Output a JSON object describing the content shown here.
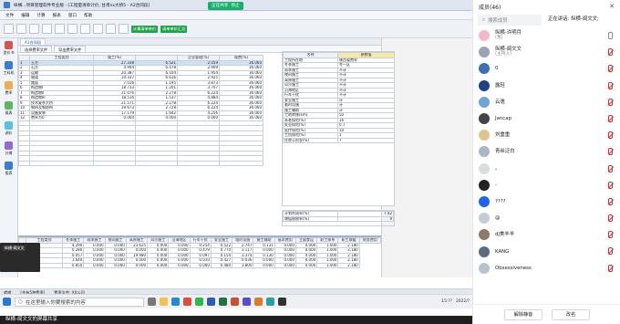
{
  "app": {
    "title": "纵横...项目管理软件专业版 - [工程量清单计价, 甘肃xx大桥5 - A2合同段]",
    "share_label": "纵横-阆文文的屏幕共享",
    "share_pill": "正在共享",
    "share_stop": "停止"
  },
  "menu": [
    "文件",
    "编辑",
    "计算",
    "报表",
    "窗口",
    "帮助"
  ],
  "toolbar": {
    "green1": "计算清单单价",
    "green2": "清单单价汇总"
  },
  "nav": [
    "造价书",
    "工料机",
    "费率",
    "报表",
    "调价",
    "分摊",
    "报表"
  ],
  "tabs": [
    "A1合同段"
  ],
  "sub_tabs": [
    "选择费率文件",
    "导出费率文件"
  ],
  "left_table": {
    "headers": [
      "工程类别",
      "施工(%)",
      "企业管理(%)",
      "规费(%)"
    ],
    "rows": [
      [
        "土方",
        "27.338",
        "6.521",
        "2.059",
        "36.060"
      ],
      [
        "石方",
        "4.994",
        "6.478",
        "2.909",
        "36.060"
      ],
      [
        "运输",
        "20.387",
        "6.104",
        "1.954",
        "36.060"
      ],
      [
        "隧道",
        "10.337",
        "6.616",
        "2.925",
        "36.060"
      ],
      [
        "路面",
        "7.016",
        "1.195",
        "3.873",
        "36.060"
      ],
      [
        "构造物I",
        "18.733",
        "1.201",
        "3.707",
        "36.060"
      ],
      [
        "构造物II",
        "21.076",
        "2.278",
        "6.224",
        "36.060"
      ],
      [
        "构造物III",
        "18.516",
        "1.537",
        "4.884",
        "36.060"
      ],
      [
        "技术复杂大桥",
        "21.571",
        "2.278",
        "6.224",
        "36.060"
      ],
      [
        "钢材及钢结构",
        "19.673",
        "2.728",
        "6.224",
        "36.060"
      ],
      [
        "设备安装",
        "17.179",
        "1.642",
        "4.256",
        "36.060"
      ],
      [
        "费率为0",
        "0.000",
        "0.000",
        "0.000",
        "36.060"
      ]
    ]
  },
  "right_table": {
    "headers": [
      "名称",
      "参数值"
    ],
    "rows": [
      [
        "工程所在地",
        "陕西省费率"
      ],
      [
        "冬季施工",
        "冬一区"
      ],
      [
        "雨季施工",
        "不计"
      ],
      [
        "夜间施工",
        "不计"
      ],
      [
        "高原施工",
        "不计"
      ],
      [
        "风沙施工",
        "不计"
      ],
      [
        "沿海地区",
        "不计"
      ],
      [
        "行车干扰",
        "不计"
      ],
      [
        "安全施工",
        "计"
      ],
      [
        "临时设施",
        "计"
      ],
      [
        "施工辅助",
        "计"
      ],
      [
        "工地转移(km)",
        "50"
      ],
      [
        "养老保险(%)",
        "16"
      ],
      [
        "失业保险(%)",
        "0.7"
      ],
      [
        "医疗保险(%)",
        "10"
      ],
      [
        "工伤保险(%)",
        "1"
      ],
      [
        "住房公积金(%)",
        "7"
      ]
    ],
    "extra_labels": [
      "计划利润率(%)",
      "增值税税率(%)"
    ],
    "extra_values": [
      "7.42",
      "9"
    ]
  },
  "bottom_table": {
    "headers": [
      "工程类别",
      "冬季施工",
      "雨季施工",
      "夜间施工",
      "高原施工",
      "风沙施工",
      "沿海地区",
      "行车干扰",
      "安全施工",
      "临时设施",
      "施工辅助",
      "基本费用",
      "主副食运",
      "职工探亲",
      "职工取暖",
      "财务费用"
    ],
    "rows": [
      [
        "土方",
        "4.290",
        "0.000",
        "0.000",
        "23.625",
        "0.000",
        "0.000",
        "0.254",
        "0.522",
        "2.747",
        "0.131",
        "0.000",
        "0.000",
        "1.000",
        "2.180"
      ],
      [
        "石方",
        "0.280",
        "0.000",
        "0.000",
        "0.000",
        "0.000",
        "0.000",
        "0.479",
        "0.770",
        "3.117",
        "0.000",
        "0.000",
        "0.000",
        "1.000",
        "2.180"
      ],
      [
        "运输",
        "0.057",
        "0.000",
        "0.000",
        "19.980",
        "0.000",
        "0.000",
        "0.097",
        "0.154",
        "3.374",
        "0.130",
        "0.000",
        "0.000",
        "1.000",
        "2.180"
      ],
      [
        "隧道",
        "1.640",
        "0.000",
        "0.000",
        "0.000",
        "0.000",
        "0.000",
        "0.010",
        "0.427",
        "0.036",
        "0.000",
        "0.000",
        "0.000",
        "1.000",
        "2.180"
      ],
      [
        "路面",
        "0.850",
        "0.000",
        "0.000",
        "0.000",
        "0.000",
        "0.000",
        "0.000",
        "0.480",
        "3.800",
        "0.000",
        "0.000",
        "0.000",
        "1.000",
        "2.180"
      ]
    ]
  },
  "statusbar": [
    "就绪",
    "[共有5种费率]",
    "费率文件: XX公司"
  ],
  "camera_label": "纵横-阆文文",
  "taskbar": {
    "search_placeholder": "在这里输入你要搜索的内容",
    "time": "15:??",
    "date": "2022/?"
  },
  "panel": {
    "title": "成员(46)",
    "search_placeholder": "搜索成员",
    "speaking": "正在讲话: 纵横-阆文文;",
    "members": [
      {
        "name": "纵横-许明月",
        "sub": "(我)"
      },
      {
        "name": "纵横-阆文文",
        "sub": "(主持人)"
      },
      {
        "name": "0",
        "sub": ""
      },
      {
        "name": "露轻",
        "sub": ""
      },
      {
        "name": "云逸",
        "sub": ""
      },
      {
        "name": "Jancap",
        "sub": ""
      },
      {
        "name": "刘重重",
        "sub": ""
      },
      {
        "name": "青丝泛白",
        "sub": ""
      },
      {
        "name": "。",
        "sub": ""
      },
      {
        "name": "-",
        "sub": ""
      },
      {
        "name": "????",
        "sub": ""
      },
      {
        "name": "@",
        "sub": ""
      },
      {
        "name": "dj美羊羊",
        "sub": ""
      },
      {
        "name": "KANG",
        "sub": ""
      },
      {
        "name": "Obsessiveness",
        "sub": ""
      }
    ],
    "mute_all": "解除静音",
    "rename": "改名"
  },
  "colors": {
    "accent": "#1d5fb8",
    "share": "#17b26a"
  }
}
